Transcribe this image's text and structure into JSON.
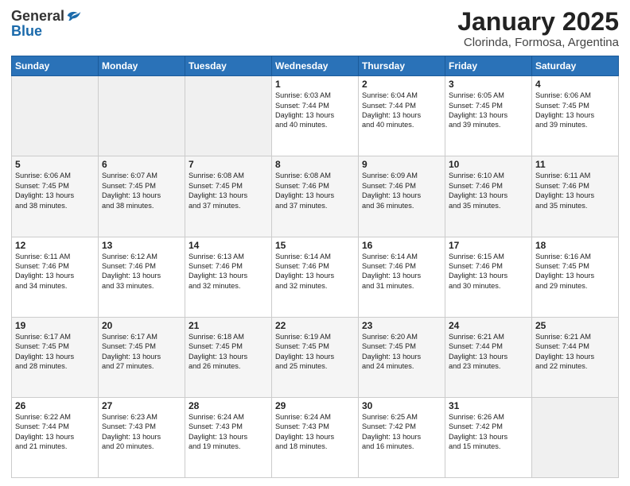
{
  "header": {
    "logo_general": "General",
    "logo_blue": "Blue",
    "title": "January 2025",
    "location": "Clorinda, Formosa, Argentina"
  },
  "days_of_week": [
    "Sunday",
    "Monday",
    "Tuesday",
    "Wednesday",
    "Thursday",
    "Friday",
    "Saturday"
  ],
  "weeks": [
    [
      {
        "day": "",
        "info": ""
      },
      {
        "day": "",
        "info": ""
      },
      {
        "day": "",
        "info": ""
      },
      {
        "day": "1",
        "info": "Sunrise: 6:03 AM\nSunset: 7:44 PM\nDaylight: 13 hours\nand 40 minutes."
      },
      {
        "day": "2",
        "info": "Sunrise: 6:04 AM\nSunset: 7:44 PM\nDaylight: 13 hours\nand 40 minutes."
      },
      {
        "day": "3",
        "info": "Sunrise: 6:05 AM\nSunset: 7:45 PM\nDaylight: 13 hours\nand 39 minutes."
      },
      {
        "day": "4",
        "info": "Sunrise: 6:06 AM\nSunset: 7:45 PM\nDaylight: 13 hours\nand 39 minutes."
      }
    ],
    [
      {
        "day": "5",
        "info": "Sunrise: 6:06 AM\nSunset: 7:45 PM\nDaylight: 13 hours\nand 38 minutes."
      },
      {
        "day": "6",
        "info": "Sunrise: 6:07 AM\nSunset: 7:45 PM\nDaylight: 13 hours\nand 38 minutes."
      },
      {
        "day": "7",
        "info": "Sunrise: 6:08 AM\nSunset: 7:45 PM\nDaylight: 13 hours\nand 37 minutes."
      },
      {
        "day": "8",
        "info": "Sunrise: 6:08 AM\nSunset: 7:46 PM\nDaylight: 13 hours\nand 37 minutes."
      },
      {
        "day": "9",
        "info": "Sunrise: 6:09 AM\nSunset: 7:46 PM\nDaylight: 13 hours\nand 36 minutes."
      },
      {
        "day": "10",
        "info": "Sunrise: 6:10 AM\nSunset: 7:46 PM\nDaylight: 13 hours\nand 35 minutes."
      },
      {
        "day": "11",
        "info": "Sunrise: 6:11 AM\nSunset: 7:46 PM\nDaylight: 13 hours\nand 35 minutes."
      }
    ],
    [
      {
        "day": "12",
        "info": "Sunrise: 6:11 AM\nSunset: 7:46 PM\nDaylight: 13 hours\nand 34 minutes."
      },
      {
        "day": "13",
        "info": "Sunrise: 6:12 AM\nSunset: 7:46 PM\nDaylight: 13 hours\nand 33 minutes."
      },
      {
        "day": "14",
        "info": "Sunrise: 6:13 AM\nSunset: 7:46 PM\nDaylight: 13 hours\nand 32 minutes."
      },
      {
        "day": "15",
        "info": "Sunrise: 6:14 AM\nSunset: 7:46 PM\nDaylight: 13 hours\nand 32 minutes."
      },
      {
        "day": "16",
        "info": "Sunrise: 6:14 AM\nSunset: 7:46 PM\nDaylight: 13 hours\nand 31 minutes."
      },
      {
        "day": "17",
        "info": "Sunrise: 6:15 AM\nSunset: 7:46 PM\nDaylight: 13 hours\nand 30 minutes."
      },
      {
        "day": "18",
        "info": "Sunrise: 6:16 AM\nSunset: 7:45 PM\nDaylight: 13 hours\nand 29 minutes."
      }
    ],
    [
      {
        "day": "19",
        "info": "Sunrise: 6:17 AM\nSunset: 7:45 PM\nDaylight: 13 hours\nand 28 minutes."
      },
      {
        "day": "20",
        "info": "Sunrise: 6:17 AM\nSunset: 7:45 PM\nDaylight: 13 hours\nand 27 minutes."
      },
      {
        "day": "21",
        "info": "Sunrise: 6:18 AM\nSunset: 7:45 PM\nDaylight: 13 hours\nand 26 minutes."
      },
      {
        "day": "22",
        "info": "Sunrise: 6:19 AM\nSunset: 7:45 PM\nDaylight: 13 hours\nand 25 minutes."
      },
      {
        "day": "23",
        "info": "Sunrise: 6:20 AM\nSunset: 7:45 PM\nDaylight: 13 hours\nand 24 minutes."
      },
      {
        "day": "24",
        "info": "Sunrise: 6:21 AM\nSunset: 7:44 PM\nDaylight: 13 hours\nand 23 minutes."
      },
      {
        "day": "25",
        "info": "Sunrise: 6:21 AM\nSunset: 7:44 PM\nDaylight: 13 hours\nand 22 minutes."
      }
    ],
    [
      {
        "day": "26",
        "info": "Sunrise: 6:22 AM\nSunset: 7:44 PM\nDaylight: 13 hours\nand 21 minutes."
      },
      {
        "day": "27",
        "info": "Sunrise: 6:23 AM\nSunset: 7:43 PM\nDaylight: 13 hours\nand 20 minutes."
      },
      {
        "day": "28",
        "info": "Sunrise: 6:24 AM\nSunset: 7:43 PM\nDaylight: 13 hours\nand 19 minutes."
      },
      {
        "day": "29",
        "info": "Sunrise: 6:24 AM\nSunset: 7:43 PM\nDaylight: 13 hours\nand 18 minutes."
      },
      {
        "day": "30",
        "info": "Sunrise: 6:25 AM\nSunset: 7:42 PM\nDaylight: 13 hours\nand 16 minutes."
      },
      {
        "day": "31",
        "info": "Sunrise: 6:26 AM\nSunset: 7:42 PM\nDaylight: 13 hours\nand 15 minutes."
      },
      {
        "day": "",
        "info": ""
      }
    ]
  ]
}
